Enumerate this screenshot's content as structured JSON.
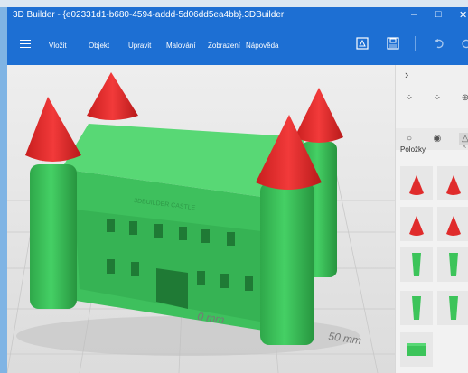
{
  "window": {
    "title": "3D Builder - {e02331d1-b680-4594-addd-5d06dd5ea4bb}.3DBuilder",
    "controls": {
      "minimize": "–",
      "maximize": "□",
      "close": "✕"
    }
  },
  "menu": {
    "items": [
      "Vložit",
      "Objekt",
      "Upravit",
      "Malování",
      "Zobrazení",
      "Nápověda"
    ],
    "tools": [
      "3d-print-icon",
      "save-icon",
      "undo-icon",
      "redo-icon"
    ]
  },
  "panel": {
    "expand_glyph": "›",
    "header": "Položky",
    "collapse_glyph": "^"
  },
  "scene": {
    "ruler_labels": [
      "0 mm",
      "50 mm"
    ],
    "castle_engraving": "3DBUILDER CASTLE"
  },
  "colors": {
    "accent": "#1d6fd3",
    "castle_green": "#3cc45a",
    "roof_red": "#e02b2b"
  }
}
